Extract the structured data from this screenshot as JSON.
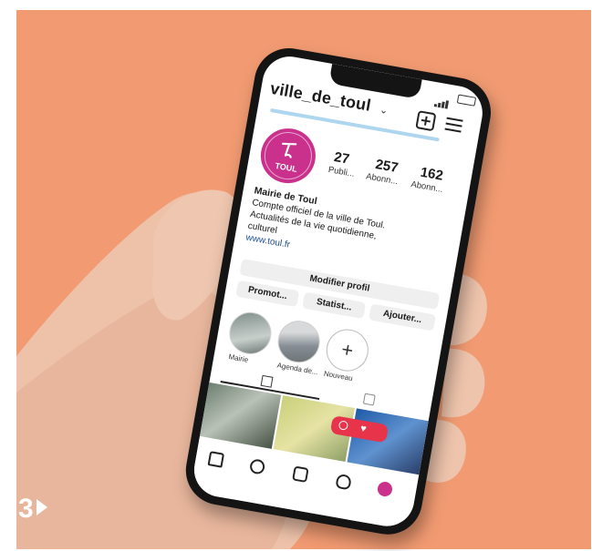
{
  "badge": {
    "number": "3"
  },
  "profile": {
    "username": "ville_de_toul",
    "avatar_text": "TOUL",
    "stats": [
      {
        "count": "27",
        "label": "Publi..."
      },
      {
        "count": "257",
        "label": "Abonn..."
      },
      {
        "count": "162",
        "label": "Abonn..."
      }
    ],
    "bio": {
      "name": "Mairie de Toul",
      "line1": "Compte officiel de la ville de Toul.",
      "line2": "Actualités de la vie quotidienne,",
      "line3": "culturel",
      "link": "www.toul.fr"
    },
    "buttons": {
      "edit": "Modifier profil",
      "a": "Promot...",
      "b": "Statist...",
      "c": "Ajouter..."
    },
    "highlights": [
      {
        "label": "Mairie"
      },
      {
        "label": "Agenda de..."
      },
      {
        "label": "Nouveau"
      }
    ]
  },
  "colors": {
    "background": "#f29b72",
    "accent": "#c9318c",
    "notification": "#e8344a"
  }
}
